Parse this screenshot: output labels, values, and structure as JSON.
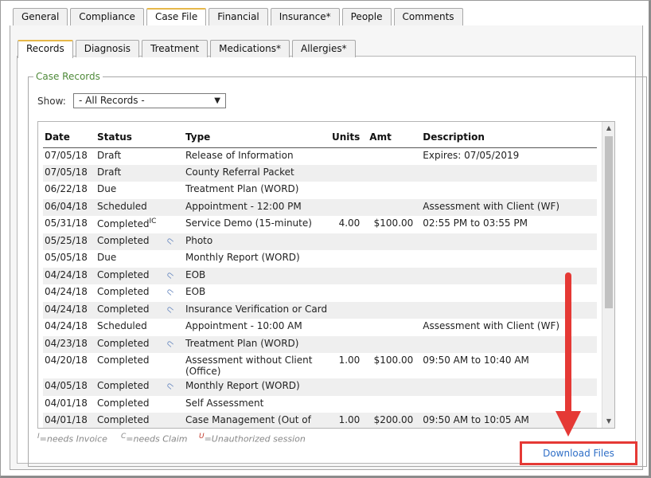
{
  "top_tabs": [
    {
      "label": "General",
      "active": false
    },
    {
      "label": "Compliance",
      "active": false
    },
    {
      "label": "Case File",
      "active": true
    },
    {
      "label": "Financial",
      "active": false
    },
    {
      "label": "Insurance*",
      "active": false
    },
    {
      "label": "People",
      "active": false
    },
    {
      "label": "Comments",
      "active": false
    }
  ],
  "sub_tabs": [
    {
      "label": "Records",
      "active": true
    },
    {
      "label": "Diagnosis",
      "active": false
    },
    {
      "label": "Treatment",
      "active": false
    },
    {
      "label": "Medications*",
      "active": false
    },
    {
      "label": "Allergies*",
      "active": false
    }
  ],
  "section_title": "Case Records",
  "filter": {
    "label": "Show:",
    "value": "- All Records -"
  },
  "table": {
    "headers": {
      "date": "Date",
      "status": "Status",
      "type": "Type",
      "units": "Units",
      "amt": "Amt",
      "description": "Description"
    },
    "rows": [
      {
        "date": "07/05/18",
        "status": "Draft",
        "sup": "",
        "attach": false,
        "type": "Release of Information",
        "units": "",
        "amt": "",
        "description": "Expires: 07/05/2019"
      },
      {
        "date": "07/05/18",
        "status": "Draft",
        "sup": "",
        "attach": false,
        "type": "County Referral Packet",
        "units": "",
        "amt": "",
        "description": ""
      },
      {
        "date": "06/22/18",
        "status": "Due",
        "sup": "",
        "attach": false,
        "type": "Treatment Plan (WORD)",
        "units": "",
        "amt": "",
        "description": ""
      },
      {
        "date": "06/04/18",
        "status": "Scheduled",
        "sup": "",
        "attach": false,
        "type": "Appointment - 12:00 PM",
        "units": "",
        "amt": "",
        "description": "Assessment with Client (WF)"
      },
      {
        "date": "05/31/18",
        "status": "Completed",
        "sup": "IC",
        "attach": false,
        "type": "Service Demo (15-minute)",
        "units": "4.00",
        "amt": "$100.00",
        "description": "02:55 PM to 03:55 PM"
      },
      {
        "date": "05/25/18",
        "status": "Completed",
        "sup": "",
        "attach": true,
        "type": "Photo",
        "units": "",
        "amt": "",
        "description": ""
      },
      {
        "date": "05/05/18",
        "status": "Due",
        "sup": "",
        "attach": false,
        "type": "Monthly Report (WORD)",
        "units": "",
        "amt": "",
        "description": ""
      },
      {
        "date": "04/24/18",
        "status": "Completed",
        "sup": "",
        "attach": true,
        "type": "EOB",
        "units": "",
        "amt": "",
        "description": ""
      },
      {
        "date": "04/24/18",
        "status": "Completed",
        "sup": "",
        "attach": true,
        "type": "EOB",
        "units": "",
        "amt": "",
        "description": ""
      },
      {
        "date": "04/24/18",
        "status": "Completed",
        "sup": "",
        "attach": true,
        "type": "Insurance Verification or Card",
        "units": "",
        "amt": "",
        "description": ""
      },
      {
        "date": "04/24/18",
        "status": "Scheduled",
        "sup": "",
        "attach": false,
        "type": "Appointment - 10:00 AM",
        "units": "",
        "amt": "",
        "description": "Assessment with Client (WF)"
      },
      {
        "date": "04/23/18",
        "status": "Completed",
        "sup": "",
        "attach": true,
        "type": "Treatment Plan (WORD)",
        "units": "",
        "amt": "",
        "description": ""
      },
      {
        "date": "04/20/18",
        "status": "Completed",
        "sup": "",
        "attach": false,
        "type": "Assessment without Client (Office)",
        "units": "1.00",
        "amt": "$100.00",
        "description": "09:50 AM to 10:40 AM"
      },
      {
        "date": "04/05/18",
        "status": "Completed",
        "sup": "",
        "attach": true,
        "type": "Monthly Report (WORD)",
        "units": "",
        "amt": "",
        "description": ""
      },
      {
        "date": "04/01/18",
        "status": "Completed",
        "sup": "",
        "attach": false,
        "type": "Self Assessment",
        "units": "",
        "amt": "",
        "description": ""
      },
      {
        "date": "04/01/18",
        "status": "Completed",
        "sup": "",
        "attach": false,
        "type": "Case Management (Out of",
        "units": "1.00",
        "amt": "$200.00",
        "description": "09:50 AM to 10:05 AM"
      }
    ]
  },
  "legend_notes": [
    {
      "sup": "I",
      "text": "=needs Invoice"
    },
    {
      "sup": "C",
      "text": "=needs Claim"
    },
    {
      "sup": "U",
      "text": "=Unauthorized session"
    }
  ],
  "download_label": "Download Files",
  "colors": {
    "link": "#2f6fc7",
    "accent_tab": "#e6b84a",
    "section_title": "#4f8a3a",
    "highlight": "#e53935"
  },
  "icons": {
    "attachment": "paperclip-icon",
    "scroll_up": "chevron-up-icon",
    "scroll_down": "chevron-down-icon",
    "dropdown": "caret-down-icon",
    "annotation": "red-arrow"
  }
}
